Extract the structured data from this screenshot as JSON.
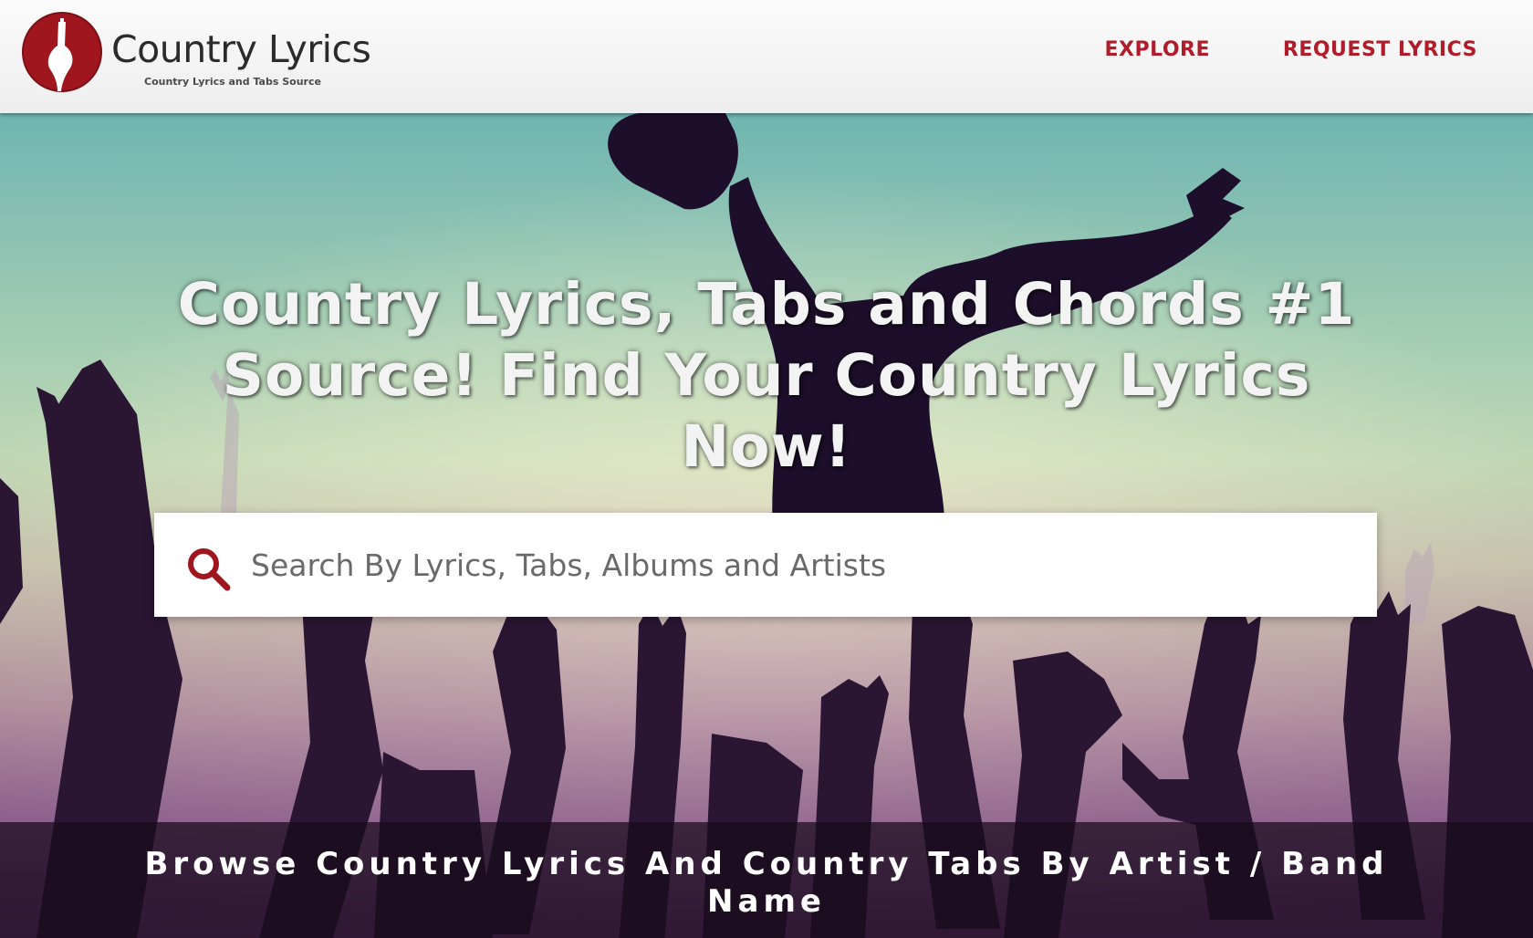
{
  "header": {
    "brand": "Country Lyrics",
    "tagline": "Country Lyrics and Tabs Source",
    "logo_icon": "guitar-logo-icon",
    "nav": [
      {
        "label": "EXPLORE"
      },
      {
        "label": "REQUEST LYRICS"
      }
    ]
  },
  "hero": {
    "headline": "Country Lyrics, Tabs and Chords #1 Source! Find Your Country Lyrics Now!",
    "search": {
      "placeholder": "Search By Lyrics, Tabs, Albums and Artists",
      "value": "",
      "icon": "search-icon"
    }
  },
  "browse": {
    "title": "Browse Country Lyrics And Country Tabs By Artist / Band Name"
  },
  "colors": {
    "accent": "#b01c2a",
    "header_bg": "#f4f4f4",
    "browse_bar_bg": "#180a1a"
  }
}
